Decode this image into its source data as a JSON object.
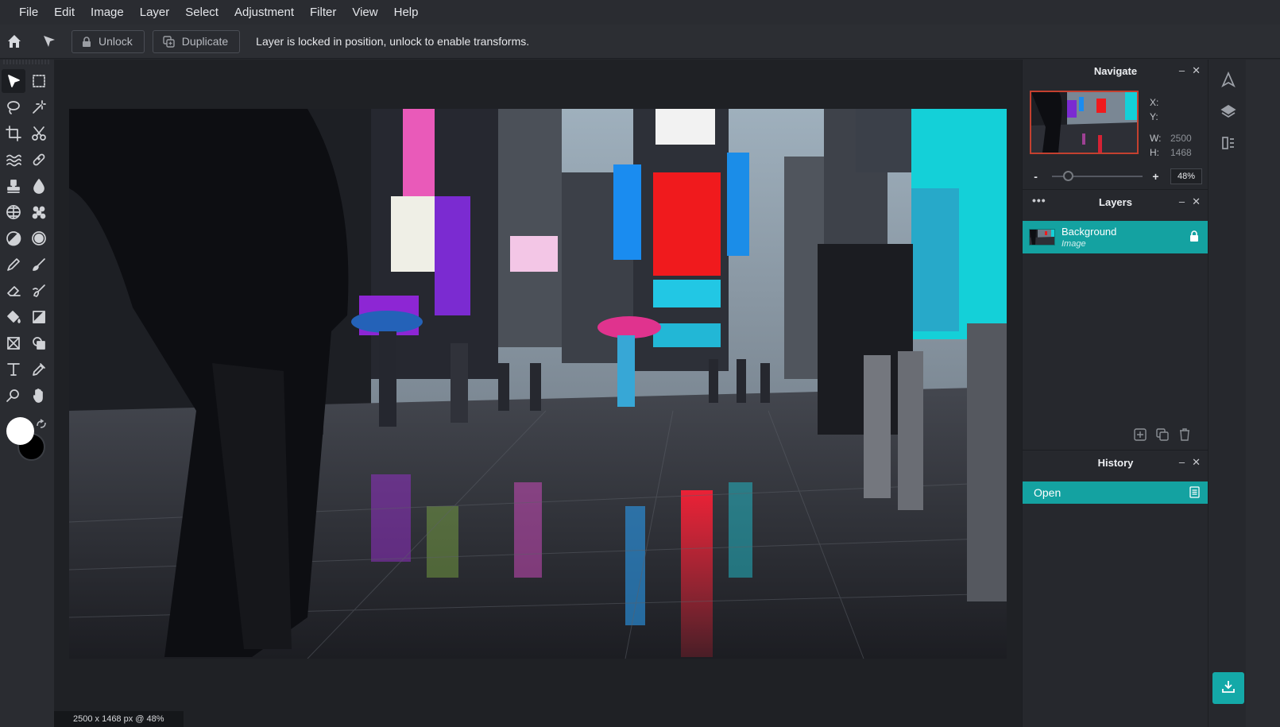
{
  "menu": [
    "File",
    "Edit",
    "Image",
    "Layer",
    "Select",
    "Adjustment",
    "Filter",
    "View",
    "Help"
  ],
  "options": {
    "unlock_label": "Unlock",
    "duplicate_label": "Duplicate",
    "message": "Layer is locked in position, unlock to enable transforms."
  },
  "navigate": {
    "title": "Navigate",
    "x_label": "X:",
    "y_label": "Y:",
    "w_label": "W:",
    "w_value": "2500",
    "h_label": "H:",
    "h_value": "1468",
    "zoom_minus": "-",
    "zoom_plus": "+",
    "zoom_value": "48%",
    "zoom_slider_fraction": 0.12
  },
  "layers": {
    "title": "Layers",
    "items": [
      {
        "name": "Background",
        "type": "Image",
        "locked": true
      }
    ]
  },
  "history": {
    "title": "History",
    "items": [
      {
        "label": "Open"
      }
    ]
  },
  "status": {
    "text": "2500 x 1468 px @ 48%"
  },
  "colors": {
    "accent": "#14a2a1",
    "foreground": "#ffffff",
    "background": "#000000"
  }
}
